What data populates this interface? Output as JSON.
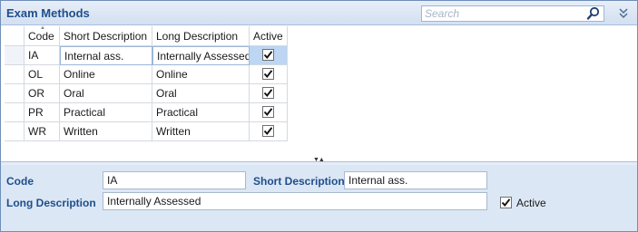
{
  "window": {
    "title": "Exam Methods"
  },
  "search": {
    "placeholder": "Search"
  },
  "grid": {
    "columns": [
      {
        "key": "code",
        "label": "Code"
      },
      {
        "key": "short",
        "label": "Short Description"
      },
      {
        "key": "long",
        "label": "Long Description"
      },
      {
        "key": "active",
        "label": "Active"
      }
    ],
    "rows": [
      {
        "code": "IA",
        "short": "Internal ass.",
        "long": "Internally Assessed",
        "active": true
      },
      {
        "code": "OL",
        "short": "Online",
        "long": "Online",
        "active": true
      },
      {
        "code": "OR",
        "short": "Oral",
        "long": "Oral",
        "active": true
      },
      {
        "code": "PR",
        "short": "Practical",
        "long": "Practical",
        "active": true
      },
      {
        "code": "WR",
        "short": "Written",
        "long": "Written",
        "active": true
      }
    ],
    "selected_row": 0,
    "sort_column": "code"
  },
  "detail": {
    "code_label": "Code",
    "code_value": "IA",
    "short_label": "Short Description",
    "short_value": "Internal ass.",
    "long_label": "Long Description",
    "long_value": "Internally Assessed",
    "active_label": "Active",
    "active_value": true
  },
  "icons": {
    "search": "search-icon",
    "collapse": "double-chevron-down-icon",
    "sort": "sort-ascending-icon",
    "splitter": "splitter-grip-icon"
  },
  "colors": {
    "title": "#1f4e8c",
    "label": "#1f4e8c",
    "detail_bg": "#dce7f5",
    "selection": "#bcd6f3",
    "border": "#6f8fb8"
  }
}
